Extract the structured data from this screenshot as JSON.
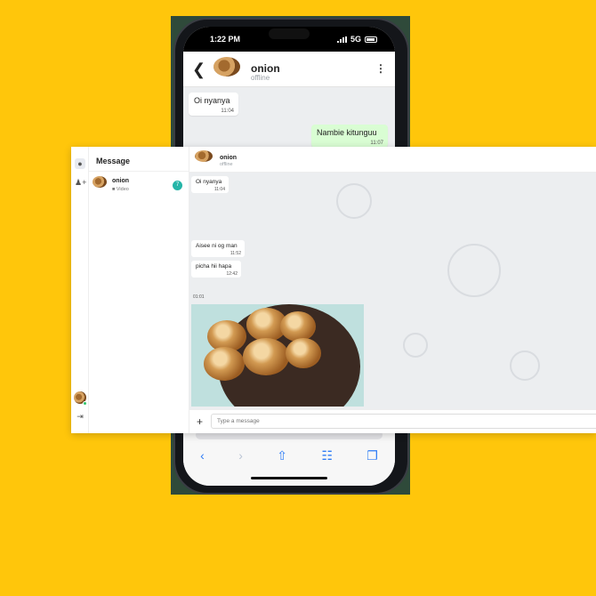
{
  "mobile": {
    "status": {
      "time": "1:22 PM",
      "network": "5G"
    },
    "header": {
      "name": "onion",
      "status": "offline"
    },
    "messages": [
      {
        "text": "Oi nyanya",
        "time": "11:04",
        "direction": "in"
      },
      {
        "text": "Nambie kitunguu",
        "time": "11:07",
        "direction": "out"
      }
    ]
  },
  "desktop": {
    "sidebar": {
      "title": "Message"
    },
    "conversations": [
      {
        "name": "onion",
        "last": "Video",
        "unread": "7"
      }
    ],
    "chat": {
      "header": {
        "name": "onion",
        "status": "offline"
      },
      "messages": [
        {
          "text": "Oi nyanya",
          "time": "11:04"
        },
        {
          "text": "Aisee ni og man",
          "time": "11:52"
        },
        {
          "text": "picha hii hapa",
          "time": "12:42"
        }
      ],
      "media_time": "01:01",
      "input_placeholder": "Type a message"
    }
  },
  "colors": {
    "background": "#ffc60b",
    "accent": "#25b5a8",
    "outgoing_bubble": "#d9fdd3"
  }
}
